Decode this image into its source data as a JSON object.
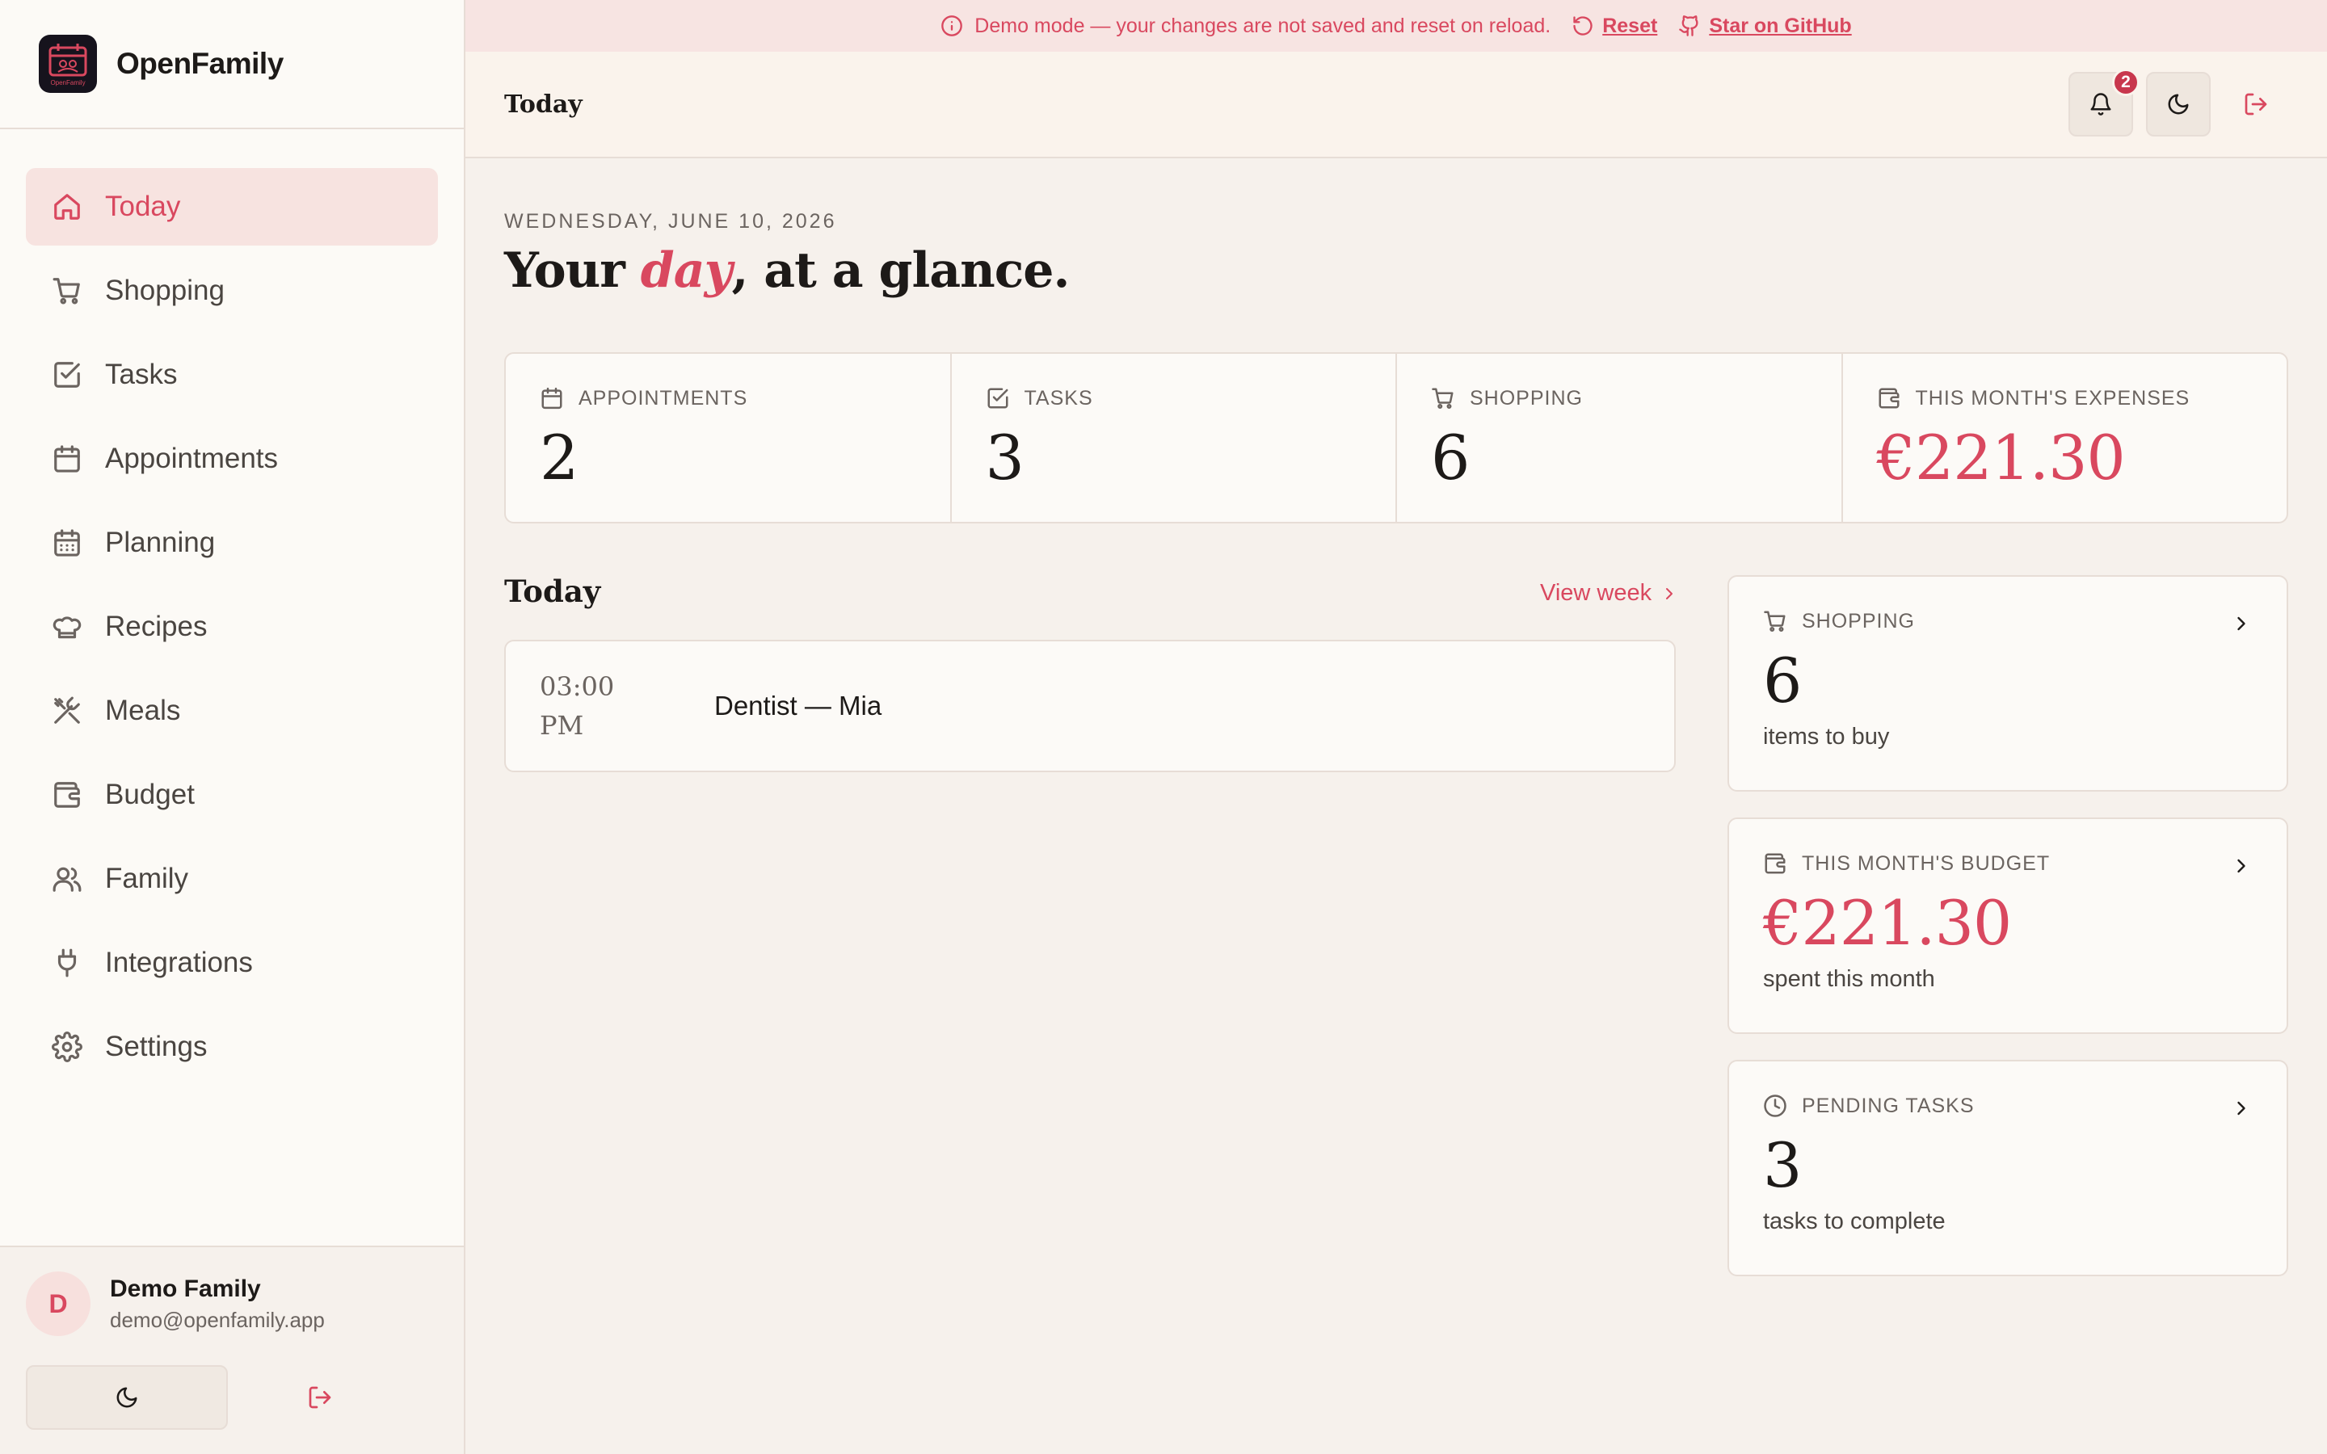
{
  "colors": {
    "accent": "#d9485f",
    "sidebar_bg": "#fcfaf6",
    "main_bg": "#f6f1ec",
    "banner_bg": "#f7e4e2"
  },
  "app": {
    "name": "OpenFamily",
    "logo_text": "OpenFamily"
  },
  "sidebar": {
    "items": [
      {
        "label": "Today",
        "icon": "home-icon",
        "active": true
      },
      {
        "label": "Shopping",
        "icon": "cart-icon"
      },
      {
        "label": "Tasks",
        "icon": "check-square-icon"
      },
      {
        "label": "Appointments",
        "icon": "calendar-icon"
      },
      {
        "label": "Planning",
        "icon": "calendar-grid-icon"
      },
      {
        "label": "Recipes",
        "icon": "chef-hat-icon"
      },
      {
        "label": "Meals",
        "icon": "utensils-icon"
      },
      {
        "label": "Budget",
        "icon": "wallet-icon"
      },
      {
        "label": "Family",
        "icon": "users-icon"
      },
      {
        "label": "Integrations",
        "icon": "plug-icon"
      },
      {
        "label": "Settings",
        "icon": "gear-icon"
      }
    ],
    "user": {
      "initial": "D",
      "name": "Demo Family",
      "email": "demo@openfamily.app"
    }
  },
  "banner": {
    "message": "Demo mode — your changes are not saved and reset on reload.",
    "reset_label": "Reset",
    "github_label": "Star on GitHub"
  },
  "header": {
    "title": "Today",
    "notification_count": "2"
  },
  "main": {
    "date": "WEDNESDAY, JUNE 10, 2026",
    "headline": {
      "before": "Your ",
      "emphasis": "day",
      "after": ", at a glance."
    },
    "stats": [
      {
        "label": "APPOINTMENTS",
        "value": "2",
        "icon": "calendar-icon"
      },
      {
        "label": "TASKS",
        "value": "3",
        "icon": "check-square-icon"
      },
      {
        "label": "SHOPPING",
        "value": "6",
        "icon": "cart-icon"
      },
      {
        "label": "THIS MONTH'S EXPENSES",
        "value": "€221.30",
        "icon": "wallet-icon"
      }
    ],
    "today": {
      "title": "Today",
      "view_week": "View week",
      "appointments": [
        {
          "time_1": "03:00",
          "time_2": "PM",
          "title": "Dentist — Mia"
        }
      ]
    },
    "cards": [
      {
        "label": "SHOPPING",
        "value": "6",
        "sub": "items to buy",
        "icon": "cart-icon"
      },
      {
        "label": "THIS MONTH'S BUDGET",
        "value": "€221.30",
        "sub": "spent this month",
        "icon": "wallet-icon"
      },
      {
        "label": "PENDING TASKS",
        "value": "3",
        "sub": "tasks to complete",
        "icon": "clock-icon"
      }
    ]
  }
}
